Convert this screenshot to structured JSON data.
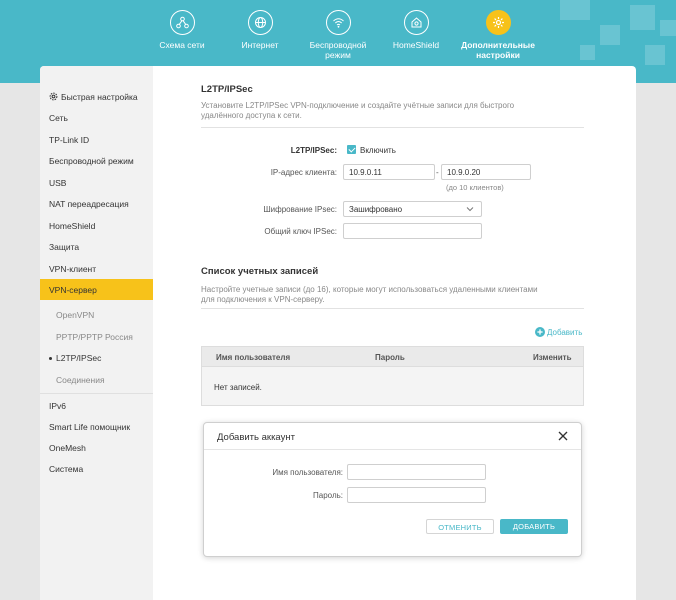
{
  "topnav": {
    "items": [
      {
        "label1": "Схема сети",
        "label2": "",
        "icon": "network-map-icon"
      },
      {
        "label1": "Интернет",
        "label2": "",
        "icon": "globe-icon"
      },
      {
        "label1": "Беспроводной",
        "label2": "режим",
        "icon": "wifi-icon"
      },
      {
        "label1": "HomeShield",
        "label2": "",
        "icon": "homeshield-icon"
      },
      {
        "label1": "Дополнительные",
        "label2": "настройки",
        "icon": "gear-icon"
      }
    ],
    "active_index": 4
  },
  "sidebar": {
    "quick_setup": "Быстрая настройка",
    "items": [
      "Сеть",
      "TP-Link ID",
      "Беспроводной режим",
      "USB",
      "NAT переадресация",
      "HomeShield",
      "Защита",
      "VPN-клиент",
      "VPN-сервер"
    ],
    "sub_items": [
      "OpenVPN",
      "PPTP/PPTP Россия",
      "L2TP/IPSec",
      "Соединения"
    ],
    "bottom_items": [
      "IPv6",
      "Smart Life помощник",
      "OneMesh",
      "Система"
    ]
  },
  "l2tp": {
    "title": "L2TP/IPSec",
    "description": "Установите L2TP/IPSec VPN-подключение и создайте учётные записи для быстрого удалённого доступа к сети.",
    "enable_label": "L2TP/IPSec:",
    "enable_text": "Включить",
    "client_ip_label": "IP-адрес клиента:",
    "ip_start": "10.9.0.11",
    "ip_separator": "-",
    "ip_end": "10.9.0.20",
    "ip_hint": "(до 10 клиентов)",
    "encryption_label": "Шифрование IPsec:",
    "encryption_value": "Зашифровано",
    "psk_label": "Общий ключ IPSec:",
    "psk_value": ""
  },
  "accounts": {
    "title": "Список учетных записей",
    "description": "Настройте учетные записи (до 16), которые могут использоваться удаленными клиентами для подключения к VPN-серверу.",
    "add_label": "Добавить",
    "columns": [
      "Имя пользователя",
      "Пароль",
      "Изменить"
    ],
    "empty_text": "Нет записей."
  },
  "dialog": {
    "title": "Добавить аккаунт",
    "username_label": "Имя пользователя:",
    "password_label": "Пароль:",
    "username_value": "",
    "password_value": "",
    "cancel_label": "ОТМЕНИТЬ",
    "add_label": "ДОБАВИТЬ"
  },
  "colors": {
    "accent": "#49b8c8",
    "active": "#f7c21a"
  }
}
